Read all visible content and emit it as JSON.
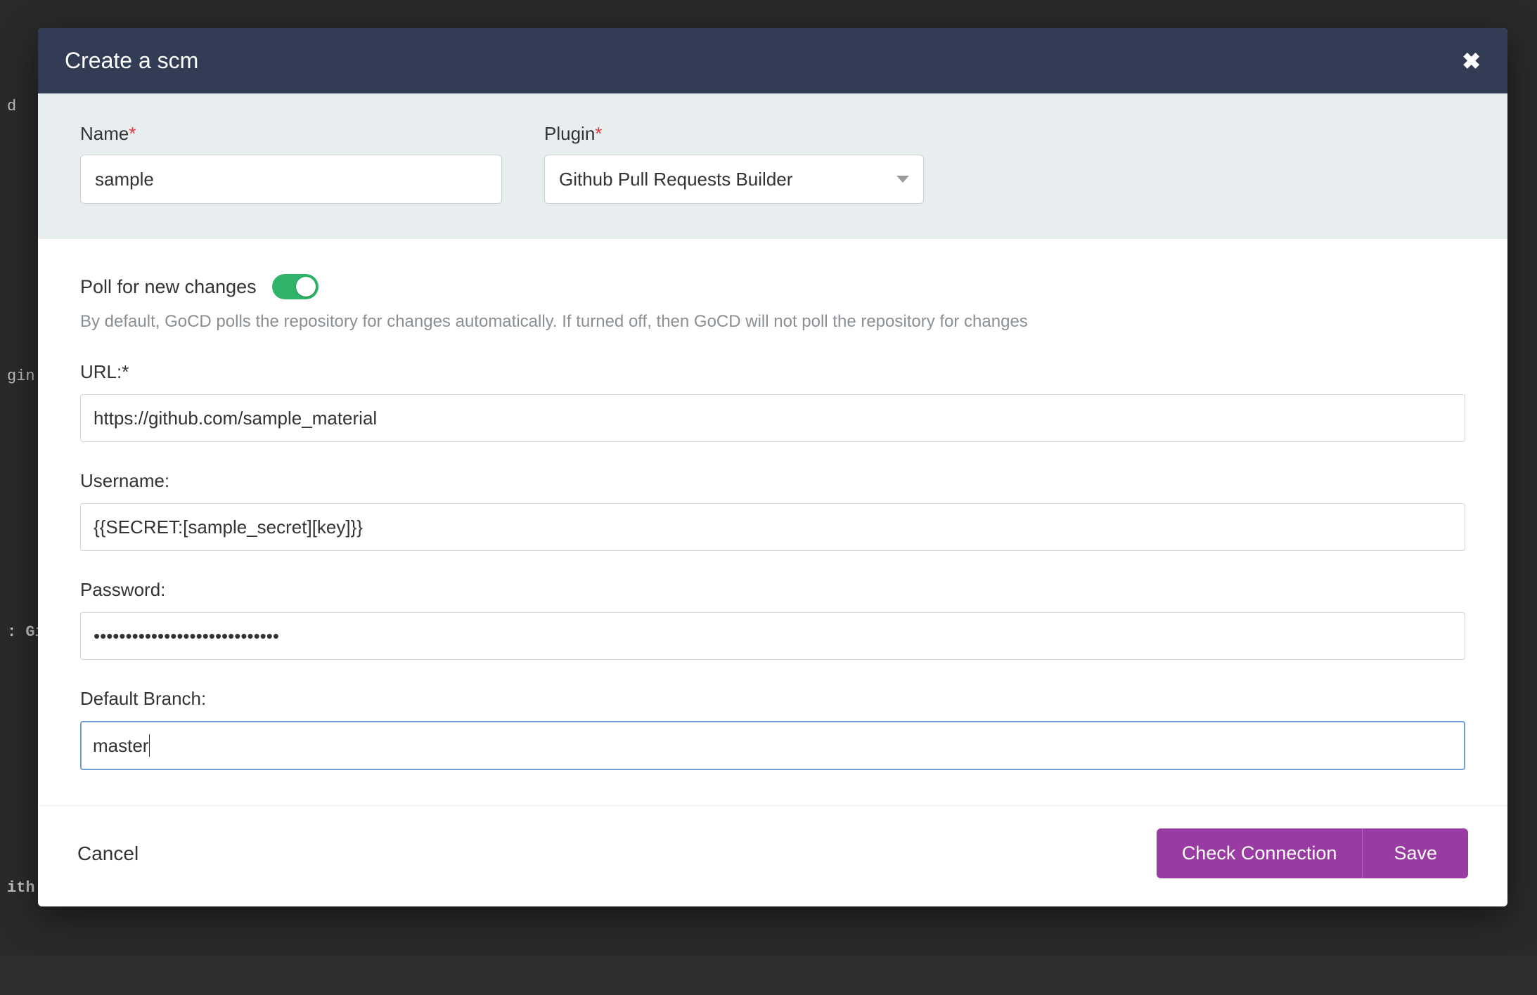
{
  "backdrop": {
    "line1": "d  :",
    "line2": "gin l",
    "line3": ": Gi",
    "line4": "ith"
  },
  "modal": {
    "title": "Create a scm",
    "top": {
      "name_label": "Name",
      "name_value": "sample",
      "plugin_label": "Plugin",
      "plugin_selected": "Github Pull Requests Builder"
    },
    "body": {
      "poll_label": "Poll for new changes",
      "poll_on": true,
      "help_text": "By default, GoCD polls the repository for changes automatically. If turned off, then GoCD will not poll the repository for changes",
      "url_label": "URL:*",
      "url_value": "https://github.com/sample_material",
      "username_label": "Username:",
      "username_value": "{{SECRET:[sample_secret][key]}}",
      "password_label": "Password:",
      "password_value": "•••••••••••••••••••••••••••••",
      "branch_label": "Default Branch:",
      "branch_value": "master"
    },
    "footer": {
      "cancel": "Cancel",
      "check": "Check Connection",
      "save": "Save"
    }
  }
}
